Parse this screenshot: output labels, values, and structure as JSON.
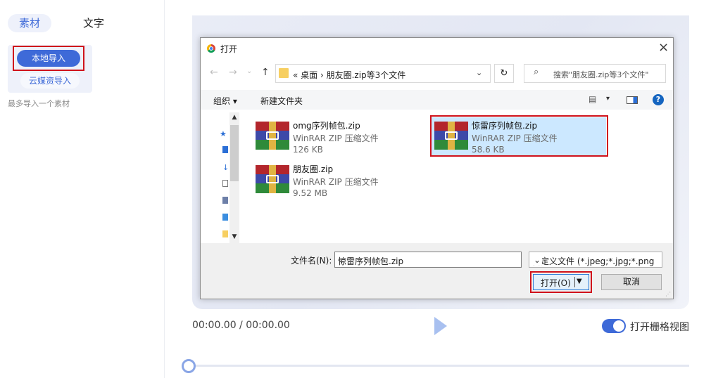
{
  "left_panel": {
    "tab_material": "素材",
    "tab_text": "文字",
    "btn_local_import": "本地导入",
    "btn_cloud_import": "云媒资导入",
    "hint": "最多导入一个素材"
  },
  "player": {
    "time": "00:00.00 / 00:00.00",
    "grid_toggle_label": "打开栅格视图",
    "grid_toggle_on": true,
    "progress": 0
  },
  "dialog": {
    "title": "打开",
    "close": "×",
    "nav": {
      "back": "←",
      "forward": "→",
      "recent": "⌄",
      "up": "↑",
      "address": "« 桌面 › 朋友圈.zip等3个文件",
      "address_dropdown": "⌄",
      "refresh": "↻",
      "search_icon": "⌕",
      "search_placeholder": "搜索\"朋友圈.zip等3个文件\""
    },
    "toolbar": {
      "organize": "组织 ▾",
      "new_folder": "新建文件夹",
      "view_icon": "▤",
      "view_dropdown": "▾",
      "help": "?"
    },
    "files": [
      {
        "name": "omg序列帧包.zip",
        "type": "WinRAR ZIP 压缩文件",
        "size": "126 KB",
        "selected": false
      },
      {
        "name": "惊雷序列帧包.zip",
        "type": "WinRAR ZIP 压缩文件",
        "size": "58.6 KB",
        "selected": true
      },
      {
        "name": "朋友圈.zip",
        "type": "WinRAR ZIP 压缩文件",
        "size": "9.52 MB",
        "selected": false
      }
    ],
    "filename_label": "文件名(N):",
    "filename_value": "惊雷序列帧包.zip",
    "filename_dropdown": "⌄",
    "filetype": "自定义文件 (*.jpeg;*.jpg;*.png",
    "filetype_dropdown": "⌄",
    "open_button": "打开(O)",
    "open_dropdown": "▼",
    "cancel_button": "取消"
  },
  "colors": {
    "accent": "#3e6ad8",
    "highlight_border": "#d0121b",
    "selected_item": "#cce8ff"
  },
  "icons": [
    "chrome-icon",
    "close-icon",
    "back-arrow-icon",
    "forward-arrow-icon",
    "up-arrow-icon",
    "folder-icon",
    "refresh-icon",
    "search-icon",
    "view-options-icon",
    "preview-pane-icon",
    "help-icon",
    "zip-archive-icon",
    "play-icon",
    "toggle-switch"
  ]
}
